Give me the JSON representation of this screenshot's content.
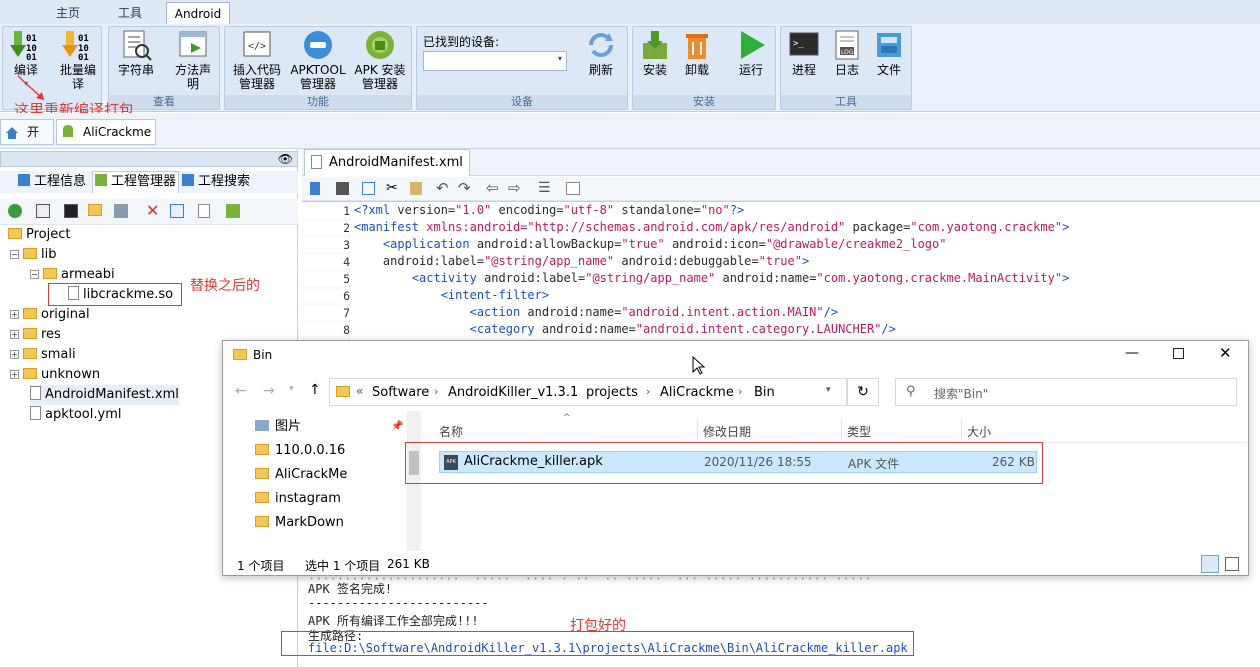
{
  "menu": {
    "tabs": [
      "主页",
      "工具",
      "Android"
    ],
    "active": "Android"
  },
  "ribbon": {
    "compile": "编译",
    "batch_compile": [
      "批量编",
      "译"
    ],
    "strings": "字符串",
    "method_decl": [
      "方法声",
      "明"
    ],
    "insert_code": [
      "插入代码",
      "管理器"
    ],
    "apktool": [
      "APKTOOL",
      "管理器"
    ],
    "apk_install": [
      "APK 安装",
      "管理器"
    ],
    "devices_label": "已找到的设备:",
    "refresh": "刷新",
    "install": "安装",
    "uninstall": "卸载",
    "run": "运行",
    "process": "进程",
    "log": "日志",
    "files": "文件",
    "groups": {
      "view": "查看",
      "function": "功能",
      "device": "设备",
      "install": "安装",
      "tools": "工具"
    }
  },
  "annotations": {
    "recompile": "这里重新编译打包",
    "replaced": "替换之后的",
    "packed": "打包好的"
  },
  "doc_tabs": {
    "start": "开始",
    "project": "AliCrackme"
  },
  "left_tabs": [
    "工程信息",
    "工程管理器",
    "工程搜索"
  ],
  "tree": {
    "root": "Project",
    "lib": "lib",
    "armeabi": "armeabi",
    "so": "libcrackme.so",
    "original": "original",
    "res": "res",
    "smali": "smali",
    "unknown": "unknown",
    "manifest": "AndroidManifest.xml",
    "apktool": "apktool.yml"
  },
  "editor": {
    "tab": "AndroidManifest.xml",
    "line_numbers": [
      "1",
      "2",
      "3",
      "4",
      "5",
      "6",
      "7",
      "8"
    ]
  },
  "explorer": {
    "title": "Bin",
    "path": [
      "Software",
      "AndroidKiller_v1.3.1",
      "projects",
      "AliCrackme",
      "Bin"
    ],
    "search_placeholder": "搜索\"Bin\"",
    "nav": [
      "图片",
      "110.0.0.16",
      "AliCrackMe",
      "instagram",
      "MarkDown"
    ],
    "columns": {
      "name": "名称",
      "date": "修改日期",
      "type": "类型",
      "size": "大小"
    },
    "file": {
      "name": "AliCrackme_killer.apk",
      "date": "2020/11/26 18:55",
      "type": "APK 文件",
      "size": "262 KB",
      "icon_text": "APK"
    },
    "status": {
      "count": "1 个项目",
      "selected": "选中 1 个项目",
      "size": "261 KB"
    }
  },
  "console": {
    "line0": "·····················  ·····  ···· · ··  ·· ·····  ··· ····· ··········· ·····",
    "line1": "APK 签名完成!",
    "line2": "-------------------------",
    "line3": "APK 所有编译工作全部完成!!!",
    "line4": "生成路径:",
    "line5": "file:D:\\Software\\AndroidKiller_v1.3.1\\projects\\AliCrackme\\Bin\\AliCrackme_killer.apk"
  }
}
